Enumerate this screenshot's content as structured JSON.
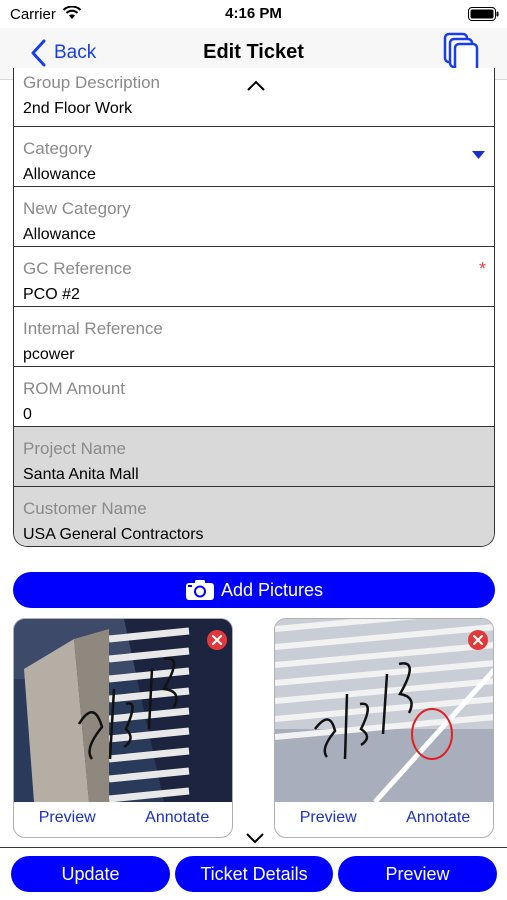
{
  "status_bar": {
    "carrier": "Carrier",
    "time": "4:16 PM"
  },
  "nav": {
    "back_label": "Back",
    "title": "Edit Ticket"
  },
  "form": {
    "fields": [
      {
        "label": "Group Description",
        "value": "2nd Floor Work"
      },
      {
        "label": "Category",
        "value": "Allowance"
      },
      {
        "label": "New Category",
        "value": "Allowance"
      },
      {
        "label": "GC Reference",
        "value": "PCO #2",
        "required_marker": "*"
      },
      {
        "label": "Internal Reference",
        "value": "pcower"
      },
      {
        "label": "ROM Amount",
        "value": "0"
      },
      {
        "label": "Project Name",
        "value": "Santa Anita Mall"
      },
      {
        "label": "Customer Name",
        "value": "USA General Contractors"
      }
    ]
  },
  "add_pictures_label": "Add Pictures",
  "photos": [
    {
      "preview_label": "Preview",
      "annotate_label": "Annotate"
    },
    {
      "preview_label": "Preview",
      "annotate_label": "Annotate"
    }
  ],
  "bottom_bar": {
    "update_label": "Update",
    "ticket_details_label": "Ticket Details",
    "preview_label": "Preview"
  },
  "colors": {
    "accent": "#0000ff",
    "link": "#1a3cf0",
    "required": "#e8414e",
    "readonly_bg": "#d9d9d9"
  },
  "icons": [
    "wifi-icon",
    "battery-icon",
    "back-chevron-icon",
    "copy-icon",
    "chevron-up-icon",
    "dropdown-arrow-icon",
    "camera-icon",
    "delete-icon",
    "chevron-down-icon"
  ]
}
